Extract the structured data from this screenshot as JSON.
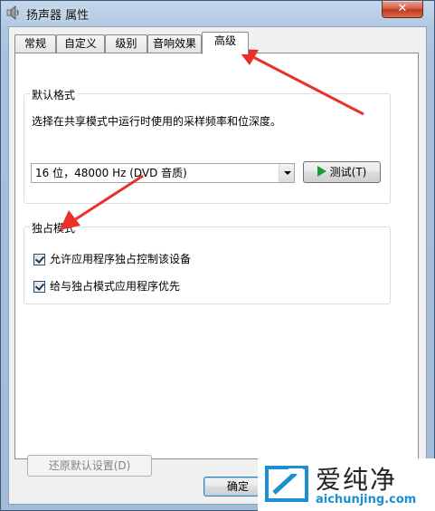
{
  "window": {
    "title": "扬声器 属性",
    "close_glyph": "✕"
  },
  "tabs": [
    {
      "label": "常规"
    },
    {
      "label": "自定义"
    },
    {
      "label": "级别"
    },
    {
      "label": "音响效果"
    },
    {
      "label": "高级",
      "active": true
    }
  ],
  "default_format": {
    "group_title": "默认格式",
    "description": "选择在共享模式中运行时使用的采样频率和位深度。",
    "format_select": {
      "value": "16 位，48000 Hz (DVD 音质)"
    },
    "test_button": "测试(T)"
  },
  "exclusive_mode": {
    "group_title": "独占模式",
    "options": [
      {
        "label": "允许应用程序独占控制该设备",
        "checked": true
      },
      {
        "label": "给与独占模式应用程序优先",
        "checked": true
      }
    ]
  },
  "restore_defaults_button": "还原默认设置(D)",
  "footer": {
    "ok_button": "确定"
  },
  "watermark": {
    "brand_cn": "爱纯净",
    "url": "aichunjing.com"
  },
  "colors": {
    "annotation_arrow": "#e8312a",
    "play_icon": "#1e9b2a",
    "watermark_url": "#1b8fd1"
  }
}
